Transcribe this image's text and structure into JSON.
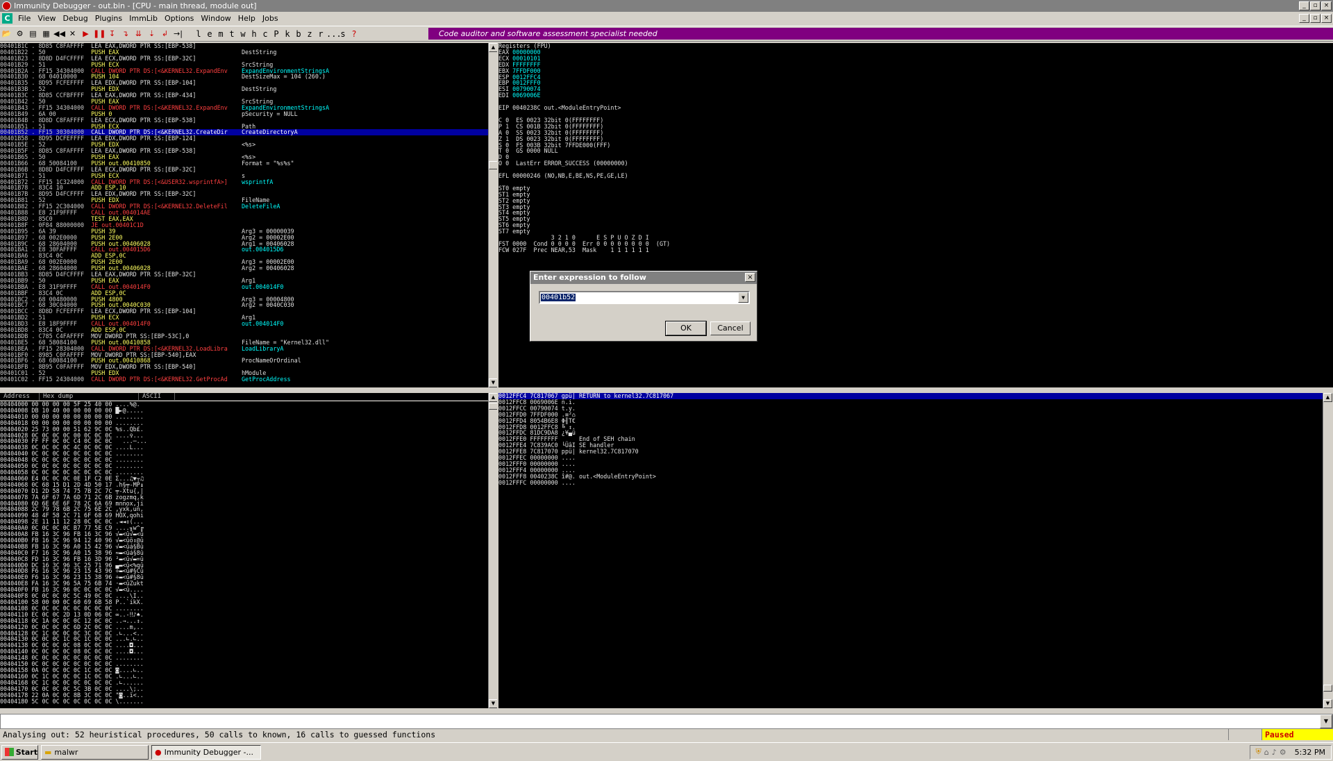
{
  "window": {
    "title": "Immunity Debugger - out.bin - [CPU - main thread, module out]"
  },
  "menu": [
    "File",
    "View",
    "Debug",
    "Plugins",
    "ImmLib",
    "Options",
    "Window",
    "Help",
    "Jobs"
  ],
  "toolbar_letters": [
    "l",
    "e",
    "m",
    "t",
    "w",
    "h",
    "c",
    "P",
    "k",
    "b",
    "z",
    "r",
    "...",
    "s",
    "?"
  ],
  "banner": "Code auditor and software assessment specialist needed",
  "disasm": [
    [
      "00401B1C",
      ". 8D85 C8FAFFFF",
      "LEA EAX,DWORD PTR SS:[EBP-538]",
      ""
    ],
    [
      "00401B22",
      ". 50",
      "PUSH EAX",
      "DestString"
    ],
    [
      "00401B23",
      ". 8D8D D4FCFFFF",
      "LEA ECX,DWORD PTR SS:[EBP-32C]",
      ""
    ],
    [
      "00401B29",
      ". 51",
      "PUSH ECX",
      "SrcString"
    ],
    [
      "00401B2A",
      ". FF15 34304000",
      "CALL DWORD PTR DS:[<&KERNEL32.ExpandEnv",
      "ExpandEnvironmentStringsA"
    ],
    [
      "00401B30",
      ". 68 04010000",
      "PUSH 104",
      "DestSizeMax = 104 (260.)"
    ],
    [
      "00401B35",
      ". 8D95 FCFEFFFF",
      "LEA EDX,DWORD PTR SS:[EBP-104]",
      ""
    ],
    [
      "00401B3B",
      ". 52",
      "PUSH EDX",
      "DestString"
    ],
    [
      "00401B3C",
      ". 8D85 CCFBFFFF",
      "LEA EAX,DWORD PTR SS:[EBP-434]",
      ""
    ],
    [
      "00401B42",
      ". 50",
      "PUSH EAX",
      "SrcString"
    ],
    [
      "00401B43",
      ". FF15 34304000",
      "CALL DWORD PTR DS:[<&KERNEL32.ExpandEnv",
      "ExpandEnvironmentStringsA"
    ],
    [
      "00401B49",
      ". 6A 00",
      "PUSH 0",
      "pSecurity = NULL"
    ],
    [
      "00401B4B",
      ". 8D8D C8FAFFFF",
      "LEA ECX,DWORD PTR SS:[EBP-538]",
      ""
    ],
    [
      "00401B51",
      ". 51",
      "PUSH ECX",
      "Path"
    ],
    [
      "00401B52",
      ". FF15 30304000",
      "CALL DWORD PTR DS:[<&KERNEL32.CreateDir",
      "CreateDirectoryA"
    ],
    [
      "00401B58",
      ". 8D95 DCFEFFFF",
      "LEA EDX,DWORD PTR SS:[EBP-124]",
      ""
    ],
    [
      "00401B5E",
      ". 52",
      "PUSH EDX",
      "<%s>"
    ],
    [
      "00401B5F",
      ". 8D85 C8FAFFFF",
      "LEA EAX,DWORD PTR SS:[EBP-538]",
      ""
    ],
    [
      "00401B65",
      ". 50",
      "PUSH EAX",
      "<%s>"
    ],
    [
      "00401B66",
      ". 68 50084100",
      "PUSH out.00410850",
      "Format = \"%s%s\""
    ],
    [
      "00401B6B",
      ". 8D8D D4FCFFFF",
      "LEA ECX,DWORD PTR SS:[EBP-32C]",
      ""
    ],
    [
      "00401B71",
      ". 51",
      "PUSH ECX",
      "s"
    ],
    [
      "00401B72",
      ". FF15 1C324000",
      "CALL DWORD PTR DS:[<&USER32.wsprintfA>]",
      "wsprintfA"
    ],
    [
      "00401B78",
      ". 83C4 10",
      "ADD ESP,10",
      ""
    ],
    [
      "00401B7B",
      ". 8D95 D4FCFFFF",
      "LEA EDX,DWORD PTR SS:[EBP-32C]",
      ""
    ],
    [
      "00401B81",
      ". 52",
      "PUSH EDX",
      "FileName"
    ],
    [
      "00401B82",
      ". FF15 2C304000",
      "CALL DWORD PTR DS:[<&KERNEL32.DeleteFil",
      "DeleteFileA"
    ],
    [
      "00401B88",
      ". E8 21F9FFFF",
      "CALL out.004014AE",
      ""
    ],
    [
      "00401B8D",
      ". 85C0",
      "TEST EAX,EAX",
      ""
    ],
    [
      "00401B8F",
      ". 0F84 88000000",
      "JE out.00401C1D",
      ""
    ],
    [
      "00401B95",
      ". 6A 39",
      "PUSH 39",
      "Arg3 = 00000039"
    ],
    [
      "00401B97",
      ". 68 002E0000",
      "PUSH 2E00",
      "Arg2 = 00002E00"
    ],
    [
      "00401B9C",
      ". 68 28604000",
      "PUSH out.00406028",
      "Arg1 = 00406028"
    ],
    [
      "00401BA1",
      ". E8 30FAFFFF",
      "CALL out.004015D6",
      "out.004015D6"
    ],
    [
      "00401BA6",
      ". 83C4 0C",
      "ADD ESP,0C",
      ""
    ],
    [
      "00401BA9",
      ". 68 002E0000",
      "PUSH 2E00",
      "Arg3 = 00002E00"
    ],
    [
      "00401BAE",
      ". 68 28604000",
      "PUSH out.00406028",
      "Arg2 = 00406028"
    ],
    [
      "00401BB3",
      ". 8D85 D4FCFFFF",
      "LEA EAX,DWORD PTR SS:[EBP-32C]",
      ""
    ],
    [
      "00401BB9",
      ". 50",
      "PUSH EAX",
      "Arg1"
    ],
    [
      "00401BBA",
      ". E8 31F9FFFF",
      "CALL out.004014F0",
      "out.004014F0"
    ],
    [
      "00401BBF",
      ". 83C4 0C",
      "ADD ESP,0C",
      ""
    ],
    [
      "00401BC2",
      ". 68 00480000",
      "PUSH 4800",
      "Arg3 = 00004800"
    ],
    [
      "00401BC7",
      ". 68 30C04000",
      "PUSH out.0040C030",
      "Arg2 = 0040C030"
    ],
    [
      "00401BCC",
      ". 8D8D FCFEFFFF",
      "LEA ECX,DWORD PTR SS:[EBP-104]",
      ""
    ],
    [
      "00401BD2",
      ". 51",
      "PUSH ECX",
      "Arg1"
    ],
    [
      "00401BD3",
      ". E8 18F9FFFF",
      "CALL out.004014F0",
      "out.004014F0"
    ],
    [
      "00401BD8",
      ". 83C4 0C",
      "ADD ESP,0C",
      ""
    ],
    [
      "00401BDB",
      ". C785 C4FAFFFF",
      "MOV DWORD PTR SS:[EBP-53C],0",
      ""
    ],
    [
      "00401BE5",
      ". 68 58084100",
      "PUSH out.00410858",
      "FileName = \"Kernel32.dll\""
    ],
    [
      "00401BEA",
      ". FF15 28304000",
      "CALL DWORD PTR DS:[<&KERNEL32.LoadLibra",
      "LoadLibraryA"
    ],
    [
      "00401BF0",
      ". 8985 C0FAFFFF",
      "MOV DWORD PTR SS:[EBP-540],EAX",
      ""
    ],
    [
      "00401BF6",
      ". 68 68084100",
      "PUSH out.00410868",
      "ProcNameOrOrdinal"
    ],
    [
      "00401BFB",
      ". 8B95 C0FAFFFF",
      "MOV EDX,DWORD PTR SS:[EBP-540]",
      ""
    ],
    [
      "00401C01",
      ". 52",
      "PUSH EDX",
      "hModule"
    ],
    [
      "00401C02",
      ". FF15 24304000",
      "CALL DWORD PTR DS:[<&KERNEL32.GetProcAd",
      "GetProcAddress"
    ]
  ],
  "disasm_selected": 14,
  "registers": {
    "header": "Registers (FPU)",
    "gp": [
      [
        "EAX",
        "00000000"
      ],
      [
        "ECX",
        "00010101"
      ],
      [
        "EDX",
        "FFFFFFFF"
      ],
      [
        "EBX",
        "7FFDF000"
      ],
      [
        "ESP",
        "0012FFC4"
      ],
      [
        "EBP",
        "0012FFF0"
      ],
      [
        "ESI",
        "00790074"
      ],
      [
        "EDI",
        "0069006E"
      ]
    ],
    "eip": "EIP 0040238C out.<ModuleEntryPoint>",
    "flags": [
      "C 0  ES 0023 32bit 0(FFFFFFFF)",
      "P 1  CS 001B 32bit 0(FFFFFFFF)",
      "A 0  SS 0023 32bit 0(FFFFFFFF)",
      "Z 1  DS 0023 32bit 0(FFFFFFFF)",
      "S 0  FS 003B 32bit 7FFDE000(FFF)",
      "T 0  GS 0000 NULL",
      "D 0",
      "O 0  LastErr ERROR_SUCCESS (00000000)"
    ],
    "efl": "EFL 00000246 (NO,NB,E,BE,NS,PE,GE,LE)",
    "st": [
      "ST0 empty",
      "ST1 empty",
      "ST2 empty",
      "ST3 empty",
      "ST4 empty",
      "ST5 empty",
      "ST6 empty",
      "ST7 empty"
    ],
    "fpu": [
      "               3 2 1 0      E S P U O Z D I",
      "FST 0000  Cond 0 0 0 0  Err 0 0 0 0 0 0 0 0  (GT)",
      "FCW 027F  Prec NEAR,53  Mask    1 1 1 1 1 1"
    ]
  },
  "dump": {
    "headers": [
      "Address",
      "Hex dump",
      "ASCII"
    ],
    "rows": [
      [
        "00404000",
        "00 00 00 00 5F 25 40 00",
        "....%@."
      ],
      [
        "00404008",
        "DB 10 40 00 00 00 00 00",
        "█►@....."
      ],
      [
        "00404010",
        "00 00 00 00 00 00 00 00",
        "........"
      ],
      [
        "00404018",
        "00 00 00 00 00 00 00 00",
        "........"
      ],
      [
        "00404020",
        "25 73 00 00 51 62 9C 0C",
        "%s..Qb£."
      ],
      [
        "00404028",
        "0C 0C 0C 0C 00 0C 0C 0C",
        "....♀..."
      ],
      [
        "00404030",
        "FF FF 0C 0C C4 0C 0C 0C",
        "  ...─..."
      ],
      [
        "00404038",
        "0C 0C 0C 0C 4C 0C 0C 0C",
        "....L..."
      ],
      [
        "00404040",
        "0C 0C 0C 0C 0C 0C 0C 0C",
        "........"
      ],
      [
        "00404048",
        "0C 0C 0C 0C 0C 0C 0C 0C",
        "........"
      ],
      [
        "00404050",
        "0C 0C 0C 0C 0C 0C 0C 0C",
        "........"
      ],
      [
        "00404058",
        "0C 0C 0C 0C 0C 0C 0C 0C",
        "........"
      ],
      [
        "00404060",
        "E4 0C 0C 0C 0E 1F C2 0E",
        "Σ...♫▼┬♫"
      ],
      [
        "00404068",
        "0C 68 15 D1 2D 4D 50 17",
        ".h§╤-MP↨"
      ],
      [
        "00404070",
        "D1 2D 58 74 75 7B 2C 7C",
        "╤-Xtu{,|"
      ],
      [
        "00404078",
        "7A 6F 67 7A 6D 71 2C 6B",
        "zogzmq,k"
      ],
      [
        "00404080",
        "6D 6E 6E 6F 78 2C 6A 69",
        "mnnox,ji"
      ],
      [
        "00404088",
        "2C 79 78 6B 2C 75 6E 2C",
        ",yxk,un,"
      ],
      [
        "00404090",
        "48 4F 58 2C 71 6F 68 69",
        "HOX,qohi"
      ],
      [
        "00404098",
        "2E 11 11 12 28 0C 0C 0C",
        ".◄◄↕(..."
      ],
      [
        "004040A0",
        "0C 0C 0C 0C B7 77 5E C9",
        "....╖w^╔"
      ],
      [
        "004040A8",
        "FB 16 3C 96 FB 16 3C 96",
        "√▬<û√▬<û"
      ],
      [
        "004040B0",
        "FB 16 3C 96 94 12 40 96",
        "√▬<ûö↕@û"
      ],
      [
        "004040B8",
        "FB 16 3C 96 A0 15 42 96",
        "√▬<ûá§Bû"
      ],
      [
        "004040C0",
        "F7 16 3C 96 A0 15 38 96",
        "≈▬<ûá§8û"
      ],
      [
        "004040C8",
        "FD 16 3C 96 FB 16 3D 96",
        "²▬<û√▬=û"
      ],
      [
        "004040D0",
        "DC 16 3C 96 3C 25 71 96",
        "▄▬<û<%qû"
      ],
      [
        "004040D8",
        "F6 16 3C 96 23 15 43 96",
        "÷▬<û#§Cû"
      ],
      [
        "004040E0",
        "F6 16 3C 96 23 15 38 96",
        "÷▬<û#§8û"
      ],
      [
        "004040E8",
        "FA 16 3C 96 5A 75 6B 74",
        "·▬<ûZukt"
      ],
      [
        "004040F0",
        "FB 16 3C 96 0C 0C 0C 0C",
        "√▬<û...."
      ],
      [
        "004040F8",
        "0C 0C 0C 0C 5C 49 0C 0C",
        "....\\I.."
      ],
      [
        "00404100",
        "58 00 00 0C 60 69 6B 58",
        "P..`ikX."
      ],
      [
        "00404108",
        "0C 0C 0C 0C 0C 0C 0C 0C",
        "........"
      ],
      [
        "00404110",
        "EC 0C 0C 2D 13 0D 06 0C",
        "∞..-‼♪♠."
      ],
      [
        "00404118",
        "0C 1A 0C 0C 0C 12 0C 0C",
        "..→...↕."
      ],
      [
        "00404120",
        "0C 0C 0C 0C 6D 2C 0C 0C",
        "....m,.."
      ],
      [
        "00404128",
        "0C 1C 0C 0C 0C 3C 0C 0C",
        ".∟...<.."
      ],
      [
        "00404130",
        "0C 0C 0C 1C 0C 1C 0C 0C",
        "...∟.∟.."
      ],
      [
        "00404138",
        "0C 0C 0C 0C 08 0C 0C 0C",
        "....◘..."
      ],
      [
        "00404140",
        "0C 0C 0C 0C 08 0C 0C 0C",
        "....◘..."
      ],
      [
        "00404148",
        "0C 0C 0C 0C 0C 0C 0C 0C",
        "........"
      ],
      [
        "00404150",
        "0C 0C 0C 0C 0C 0C 0C 0C",
        "........"
      ],
      [
        "00404158",
        "0A 0C 0C 0C 0C 1C 0C 0C",
        "◙....∟.."
      ],
      [
        "00404160",
        "0C 1C 0C 0C 0C 1C 0C 0C",
        ".∟...∟.."
      ],
      [
        "00404168",
        "0C 1C 0C 0C 0C 0C 0C 0C",
        ".∟......"
      ],
      [
        "00404170",
        "0C 0C 0C 0C 5C 3B 0C 0C",
        "....\\;.."
      ],
      [
        "00404178",
        "22 0A 0C 0C 8B 3C 0C 0C",
        "\"◙..ï<.."
      ],
      [
        "00404180",
        "5C 0C 0C 0C 0C 0C 0C 0C",
        "\\......."
      ]
    ]
  },
  "stack": {
    "rows": [
      [
        "0012FFC4",
        "7C817067",
        "gpü|",
        "RETURN to kernel32.7C817067"
      ],
      [
        "0012FFC8",
        "0069006E",
        "n.i.",
        ""
      ],
      [
        "0012FFCC",
        "00790074",
        "t.y.",
        ""
      ],
      [
        "0012FFD0",
        "7FFDF000",
        ".≡²⌂",
        ""
      ],
      [
        "0012FFD4",
        "8054B6E8",
        "Φ╢T€",
        ""
      ],
      [
        "0012FFD8",
        "0012FFC8",
        "╚ ↕.",
        ""
      ],
      [
        "0012FFDC",
        "81DC9DA8",
        "¿¥▄ü",
        ""
      ],
      [
        "0012FFE0",
        "FFFFFFFF",
        "    ",
        "End of SEH chain"
      ],
      [
        "0012FFE4",
        "7C839AC0",
        "└ÜâI",
        "SE handler"
      ],
      [
        "0012FFE8",
        "7C817070",
        "ppü|",
        "kernel32.7C817070"
      ],
      [
        "0012FFEC",
        "00000000",
        "....",
        ""
      ],
      [
        "0012FFF0",
        "00000000",
        "....",
        ""
      ],
      [
        "0012FFF4",
        "00000000",
        "....",
        ""
      ],
      [
        "0012FFF8",
        "0040238C",
        "î#@.",
        "out.<ModuleEntryPoint>"
      ],
      [
        "0012FFFC",
        "00000000",
        "....",
        ""
      ]
    ]
  },
  "status": {
    "text": "Analysing out: 52 heuristical procedures, 50 calls to known, 16 calls to guessed functions",
    "state": "Paused"
  },
  "taskbar": {
    "start": "Start",
    "items": [
      "malwr",
      "Immunity Debugger -..."
    ],
    "time": "5:32 PM"
  },
  "dialog": {
    "title": "Enter expression to follow",
    "value": "00401b52",
    "ok": "OK",
    "cancel": "Cancel"
  }
}
